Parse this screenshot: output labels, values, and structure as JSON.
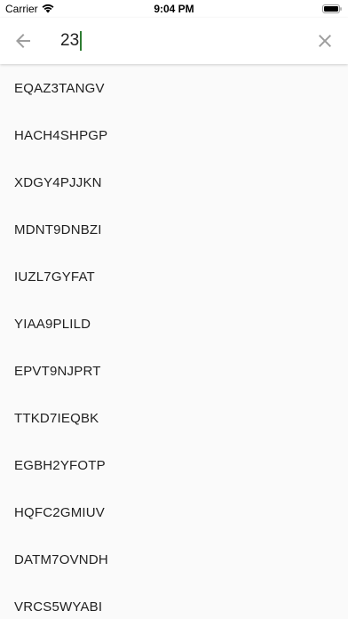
{
  "status_bar": {
    "carrier": "Carrier",
    "time": "9:04 PM"
  },
  "search": {
    "query": "23",
    "back_icon": "arrow-left-icon",
    "clear_icon": "close-icon",
    "caret_color": "#2e7d32"
  },
  "results": [
    "EQAZ3TANGV",
    "HACH4SHPGP",
    "XDGY4PJJKN",
    "MDNT9DNBZI",
    "IUZL7GYFAT",
    "YIAA9PLILD",
    "EPVT9NJPRT",
    "TTKD7IEQBK",
    "EGBH2YFOTP",
    "HQFC2GMIUV",
    "DATM7OVNDH",
    "VRCS5WYABI"
  ]
}
